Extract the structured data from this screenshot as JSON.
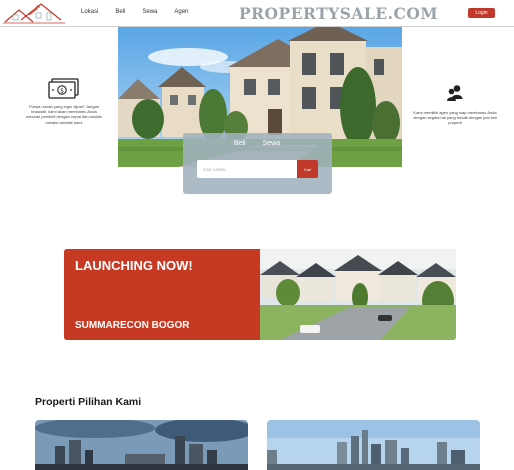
{
  "header": {
    "nav": [
      "Lokasi",
      "Beli",
      "Sewa",
      "Agen"
    ],
    "brand": "PROPERTYSALE.COM",
    "login_label": "Login"
  },
  "features": {
    "left_text": "Punya rumah yang ingin dijual? Jangan khawatir, kami akan membantu Anda mencari pembeli dengan cepat dan mudah melalui website kami",
    "right_text": "Kami memiliki agen yang siap membantu Anda dengan segala hal yang terkait dengan jual beli properti"
  },
  "search": {
    "tabs": [
      "Beli",
      "Sewa"
    ],
    "placeholder": "Cari Lokasi",
    "button_label": "Cari"
  },
  "banner": {
    "title": "LAUNCHING NOW!",
    "subtitle": "SUMMARECON BOGOR"
  },
  "section": {
    "title": "Properti Pilihan Kami"
  },
  "colors": {
    "accent": "#c0392b",
    "brand_gray": "#9aa3a9"
  },
  "icons": [
    "house-logo-icon",
    "money-icon",
    "people-icon"
  ]
}
